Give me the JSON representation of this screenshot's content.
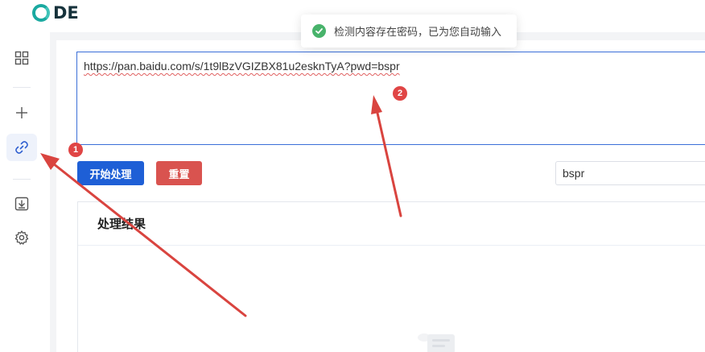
{
  "app": {
    "logo_text": "DE"
  },
  "sidebar": {
    "items": [
      {
        "icon": "grid-icon"
      },
      {
        "icon": "plus-icon"
      },
      {
        "icon": "link-icon",
        "active": true
      },
      {
        "icon": "download-icon"
      },
      {
        "icon": "gear-icon"
      }
    ]
  },
  "toast": {
    "message": "检测内容存在密码，已为您自动输入"
  },
  "input": {
    "url_text": "https://pan.baidu.com/s/1t9lBzVGIZBX81u2esknTyA?pwd=bspr"
  },
  "actions": {
    "start_label": "开始处理",
    "reset_label": "重置"
  },
  "password": {
    "value": "bspr"
  },
  "result": {
    "title": "处理结果"
  },
  "annotations": {
    "marker_1": "1",
    "marker_2": "2"
  },
  "colors": {
    "primary": "#1e5fd6",
    "danger": "#d9534f",
    "success": "#48b36b",
    "annotation": "#e04545"
  }
}
